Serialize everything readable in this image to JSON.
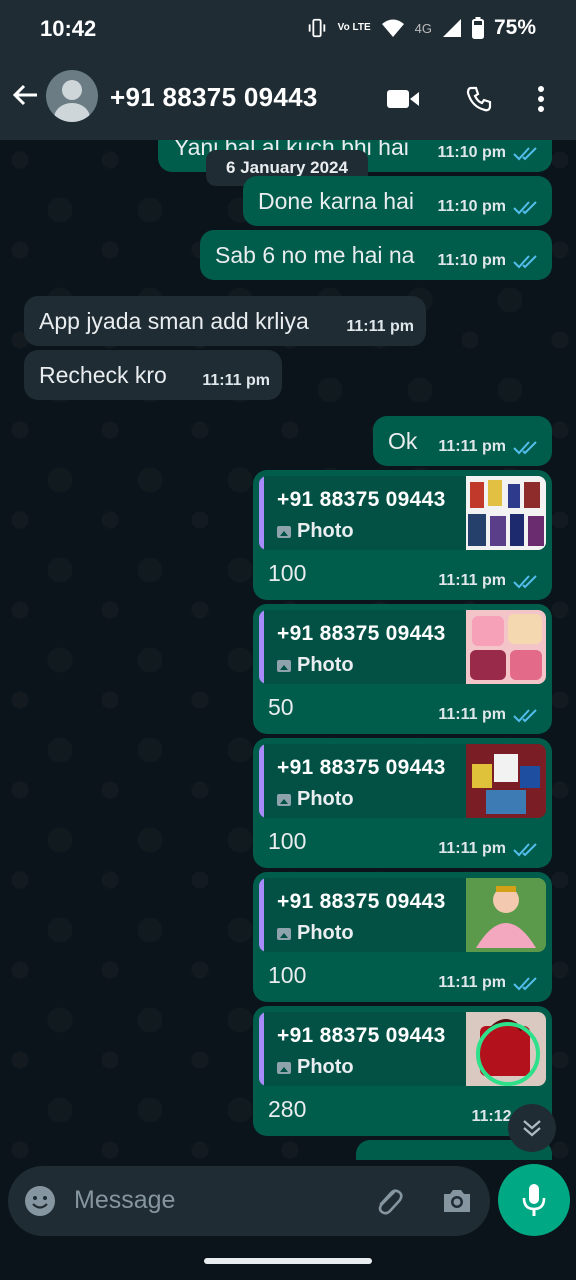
{
  "status_bar": {
    "time": "10:42",
    "lte_label": "Vo LTE",
    "network": "4G",
    "battery": "75%"
  },
  "header": {
    "contact": "+91 88375 09443",
    "icons": [
      "back-arrow-icon",
      "video-call-icon",
      "voice-call-icon",
      "more-icon"
    ]
  },
  "chat": {
    "date_chip": "6 January 2024",
    "partial_top": {
      "text": "Yani bal al kuch bhi hai",
      "time": "11:10 pm"
    },
    "messages": [
      {
        "dir": "out",
        "text": "Done karna hai",
        "time": "11:10 pm"
      },
      {
        "dir": "out",
        "text": "Sab 6 no me hai na",
        "time": "11:10 pm"
      },
      {
        "dir": "in",
        "text": "App jyada sman add krliya",
        "time": "11:11 pm"
      },
      {
        "dir": "in",
        "text": "Recheck kro",
        "time": "11:11 pm"
      },
      {
        "dir": "out",
        "text": "Ok",
        "time": "11:11 pm"
      }
    ],
    "replies": [
      {
        "quoted": "+91 88375 09443",
        "quoted_type": "Photo",
        "amount": "100",
        "time": "11:11 pm",
        "read": true
      },
      {
        "quoted": "+91 88375 09443",
        "quoted_type": "Photo",
        "amount": "50",
        "time": "11:11 pm",
        "read": true
      },
      {
        "quoted": "+91 88375 09443",
        "quoted_type": "Photo",
        "amount": "100",
        "time": "11:11 pm",
        "read": true
      },
      {
        "quoted": "+91 88375 09443",
        "quoted_type": "Photo",
        "amount": "100",
        "time": "11:11 pm",
        "read": true
      },
      {
        "quoted": "+91 88375 09443",
        "quoted_type": "Photo",
        "amount": "280",
        "time": "11:12 pm",
        "read": false
      }
    ]
  },
  "composer": {
    "placeholder": "Message"
  },
  "colors": {
    "outgoing": "#005c4b",
    "incoming": "#1f2c34",
    "accent": "#00a884",
    "ticks": "#53bdeb"
  }
}
